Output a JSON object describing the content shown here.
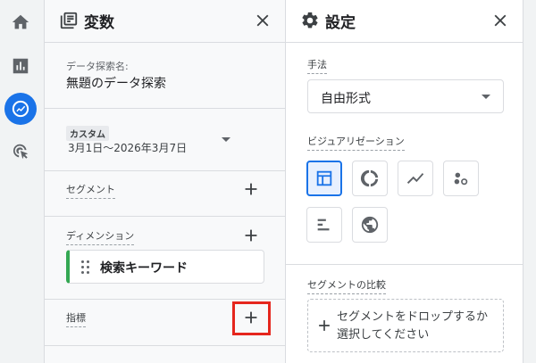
{
  "rail": {
    "items": [
      {
        "name": "home",
        "active": false
      },
      {
        "name": "reports",
        "active": false
      },
      {
        "name": "explore",
        "active": true
      },
      {
        "name": "advertising",
        "active": false
      }
    ]
  },
  "variables_panel": {
    "title": "変数",
    "exploration_name_label": "データ探索名:",
    "exploration_name_value": "無題のデータ探索",
    "date_range_tag": "カスタム",
    "date_range_value": "3月1日～2026年3月7日",
    "segments_label": "セグメント",
    "dimensions_label": "ディメンション",
    "dimension_chip": "検索キーワード",
    "metrics_label": "指標"
  },
  "settings_panel": {
    "title": "設定",
    "technique_label": "手法",
    "technique_value": "自由形式",
    "visualization_label": "ビジュアリゼーション",
    "segment_comparison_label": "セグメントの比較",
    "drop_text": "セグメントをドロップするか選択してください"
  },
  "colors": {
    "accent": "#1a73e8",
    "dimension_chip_accent": "#34a853",
    "highlight_box": "#e5261d"
  }
}
